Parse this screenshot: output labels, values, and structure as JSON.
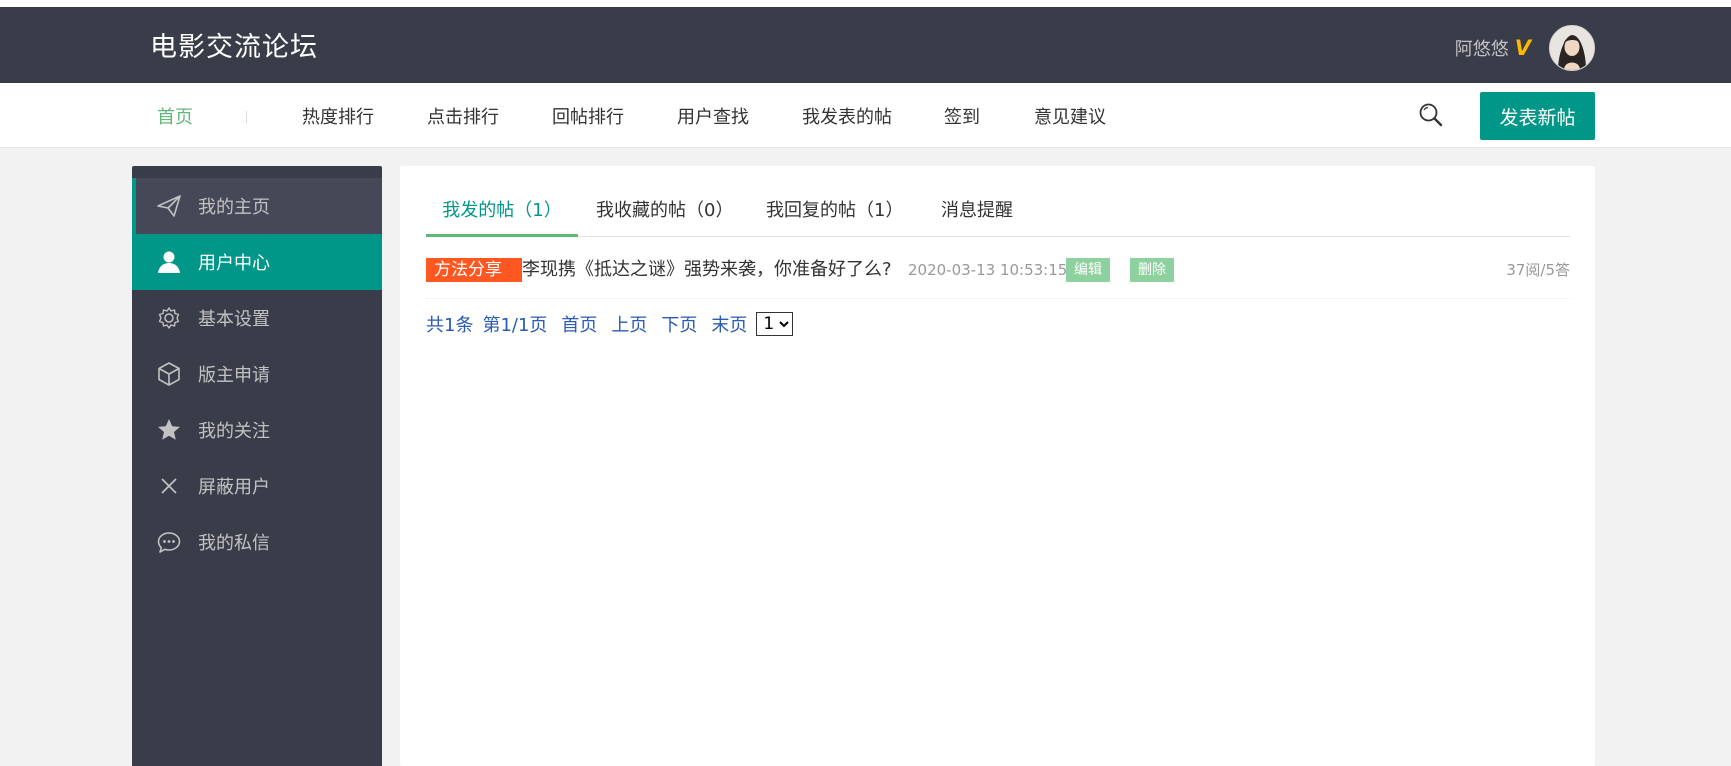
{
  "header": {
    "logo": "电影交流论坛",
    "user_name": "阿悠悠",
    "vip_badge": "V"
  },
  "nav": {
    "items": [
      "首页",
      "热度排行",
      "点击排行",
      "回帖排行",
      "用户查找",
      "我发表的帖",
      "签到",
      "意见建议"
    ],
    "post_button": "发表新帖"
  },
  "sidebar": {
    "items": [
      {
        "label": "我的主页",
        "icon": "paper-plane-icon"
      },
      {
        "label": "用户中心",
        "icon": "user-icon"
      },
      {
        "label": "基本设置",
        "icon": "gear-icon"
      },
      {
        "label": "版主申请",
        "icon": "cube-icon"
      },
      {
        "label": "我的关注",
        "icon": "star-icon"
      },
      {
        "label": "屏蔽用户",
        "icon": "close-icon"
      },
      {
        "label": "我的私信",
        "icon": "chat-icon"
      }
    ]
  },
  "tabs": [
    {
      "label": "我发的帖（1）"
    },
    {
      "label": "我收藏的帖（0）"
    },
    {
      "label": "我回复的帖（1）"
    },
    {
      "label": "消息提醒"
    }
  ],
  "posts": [
    {
      "category": "方法分享",
      "title": "李现携《抵达之谜》强势来袭，你准备好了么?",
      "time": "2020-03-13 10:53:15",
      "edit_label": "编辑",
      "delete_label": "删除",
      "stats": "37阅/5答"
    }
  ],
  "pager": {
    "total": "共1条",
    "page_info": "第1/1页",
    "first": "首页",
    "prev": "上页",
    "next": "下页",
    "last": "末页",
    "selected": "1"
  },
  "colors": {
    "header_bg": "#393d49",
    "accent": "#009688",
    "active_nav": "#5fb878",
    "category_tag": "#ff5722",
    "mini_button": "#8fd19e",
    "vip": "#ffb800"
  }
}
